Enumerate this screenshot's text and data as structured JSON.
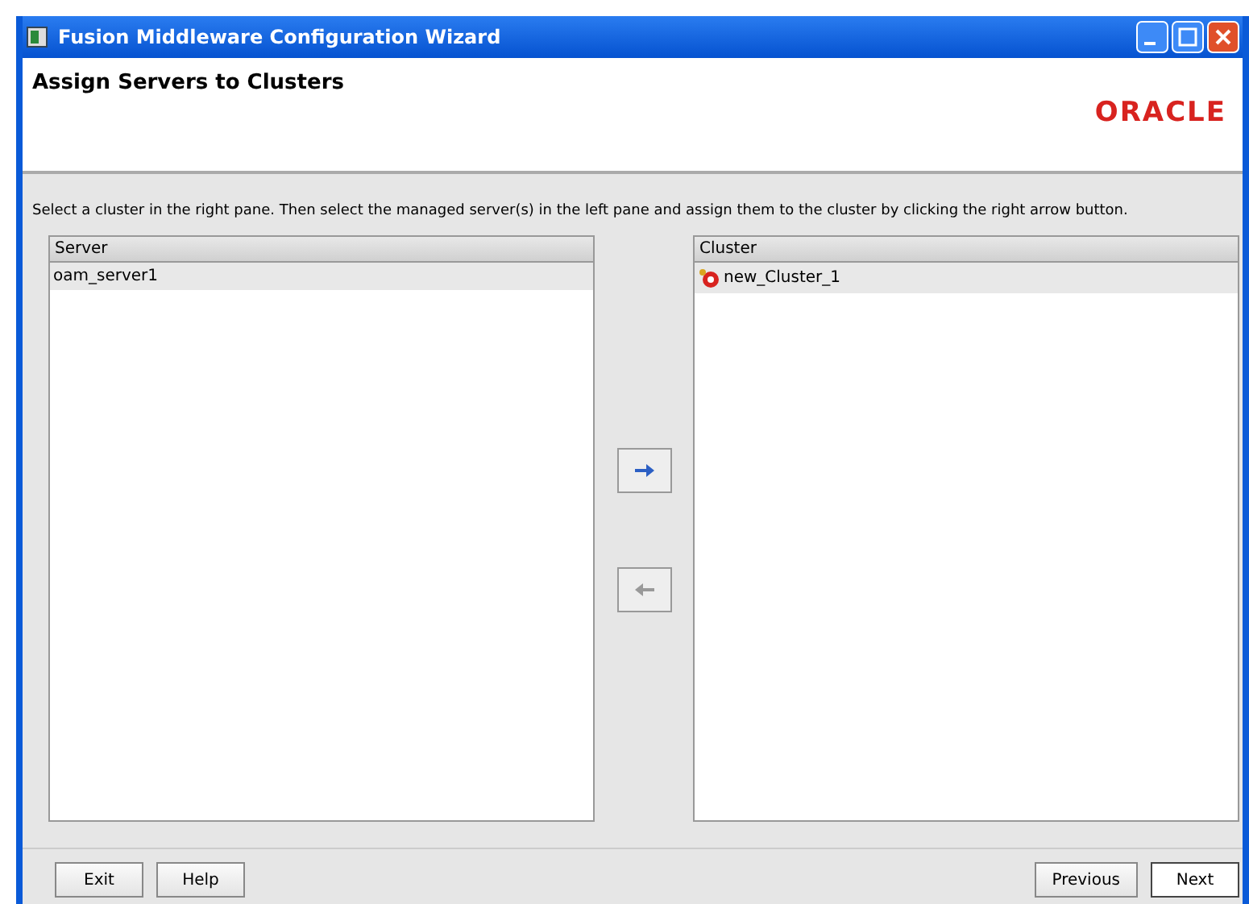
{
  "window": {
    "title": "Fusion Middleware Configuration Wizard"
  },
  "header": {
    "title": "Assign Servers to Clusters",
    "logo": "ORACLE"
  },
  "instruction": "Select a cluster in the right pane. Then select the managed server(s) in the left pane and assign them to the cluster by clicking the right arrow button.",
  "server_pane": {
    "heading": "Server",
    "items": [
      {
        "label": "oam_server1",
        "selected": true
      }
    ]
  },
  "assign_buttons": [
    {
      "kind": "right",
      "disabled": false
    },
    {
      "kind": "left",
      "disabled": true
    }
  ],
  "cluster_pane": {
    "heading": "Cluster",
    "items": [
      {
        "label": "new_Cluster_1",
        "selected": true
      }
    ]
  },
  "buttons": [
    {
      "label": "Exit",
      "default": false
    },
    {
      "label": "Help",
      "default": false
    },
    {
      "label": "Previous",
      "default": false
    },
    {
      "label": "Next",
      "default": true
    }
  ]
}
